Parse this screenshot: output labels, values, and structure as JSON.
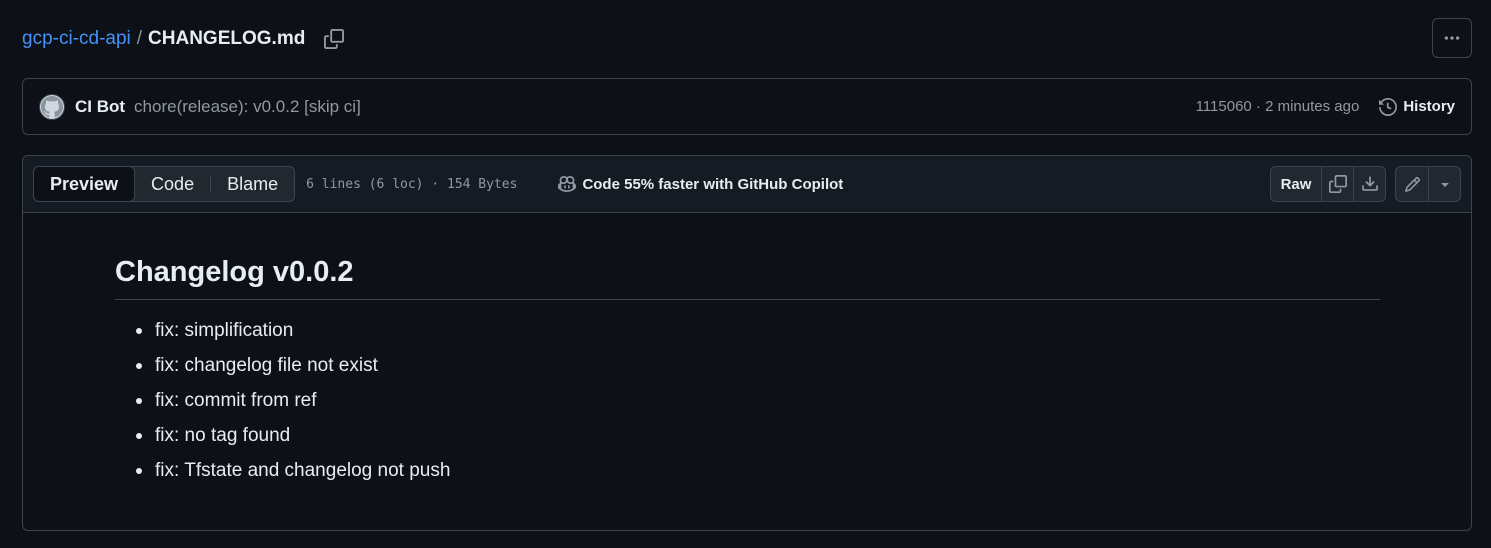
{
  "breadcrumb": {
    "repo": "gcp-ci-cd-api",
    "separator": "/",
    "file": "CHANGELOG.md"
  },
  "commit": {
    "author": "CI Bot",
    "message": "chore(release): v0.0.2 [skip ci]",
    "sha_time": "1115060 · 2 minutes ago",
    "history_label": "History"
  },
  "file_header": {
    "tabs": [
      "Preview",
      "Code",
      "Blame"
    ],
    "active_tab": "Preview",
    "meta": "6 lines (6 loc) · 154 Bytes",
    "copilot_label": "Code 55% faster with GitHub Copilot",
    "raw_label": "Raw"
  },
  "markdown": {
    "heading": "Changelog v0.0.2",
    "items": [
      "fix: simplification",
      "fix: changelog file not exist",
      "fix: commit from ref",
      "fix: no tag found",
      "fix: Tfstate and changelog not push"
    ]
  },
  "icons": {
    "copy_path": "copy-icon",
    "more": "kebab-horizontal-icon",
    "history": "history-icon",
    "copilot": "copilot-icon",
    "copy_raw": "copy-icon",
    "download": "download-icon",
    "edit": "pencil-icon",
    "dropdown": "triangle-down-icon"
  },
  "colors": {
    "background": "#0d1117",
    "link": "#4493f8",
    "border": "#3d444d",
    "muted_text": "#9198a1"
  }
}
